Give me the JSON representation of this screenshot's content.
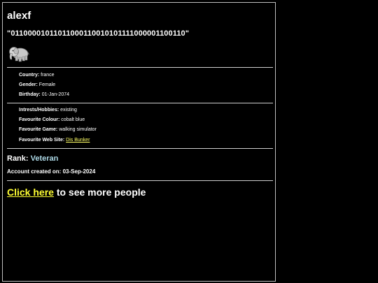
{
  "profile": {
    "username": "alexf",
    "motto": "\"01100001011011000110010101111000001100110\"",
    "avatar_icon": "elephant-icon"
  },
  "details": {
    "country_label": "Country:",
    "country_value": "france",
    "gender_label": "Gender:",
    "gender_value": "Female",
    "birthday_label": "Birthday:",
    "birthday_value": "01-Jan-2074"
  },
  "interests": {
    "hobbies_label": "Intrests/Hobbies:",
    "hobbies_value": "existing",
    "colour_label": "Favourite Colour:",
    "colour_value": "cobalt blue",
    "game_label": "Favourite Game:",
    "game_value": "walking simulator",
    "website_label": "Favourite Web Site:",
    "website_value": "Dis Bunker"
  },
  "rank": {
    "label": "Rank:",
    "value": "Veteran"
  },
  "account": {
    "created_text": "Account created on: 03-Sep-2024"
  },
  "footer": {
    "link_text": "Click here",
    "rest_text": " to see more people"
  },
  "colors": {
    "background": "#000000",
    "text": "#ffffff",
    "link": "#ffff33",
    "rank": "#add8e6"
  }
}
